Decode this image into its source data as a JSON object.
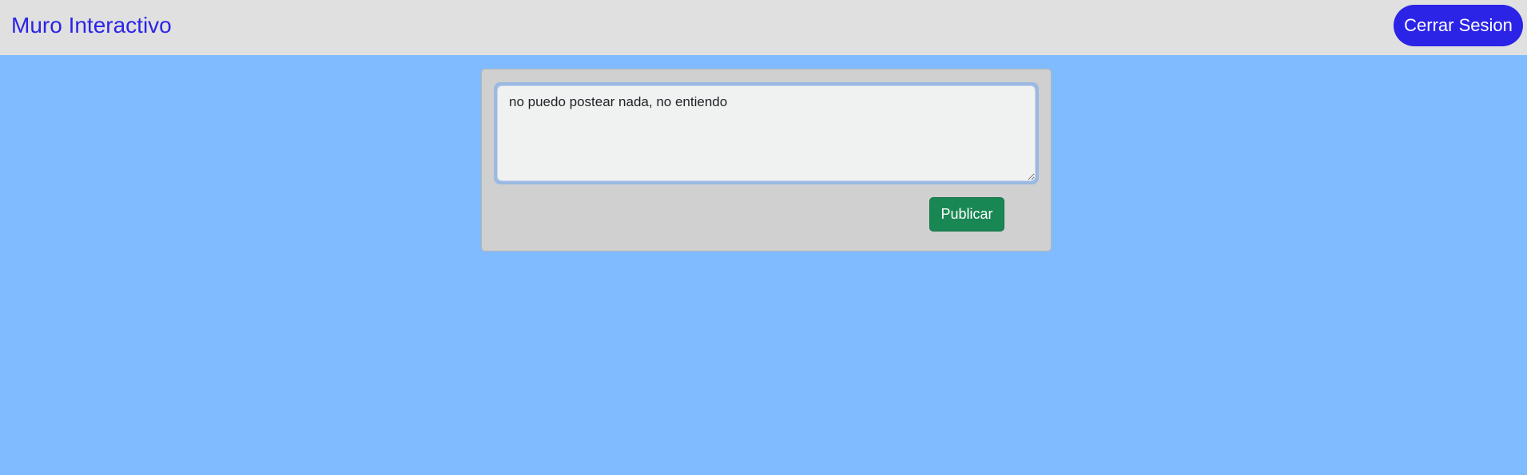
{
  "header": {
    "brand": "Muro Interactivo",
    "logout_label": "Cerrar Sesion"
  },
  "composer": {
    "textarea_value": "no puedo postear nada, no entiendo",
    "publish_label": "Publicar"
  },
  "colors": {
    "page_background": "#80bbff",
    "header_background": "#e0e0e0",
    "brand": "#2b24e6",
    "logout_button": "#2b24e6",
    "card_background": "#d0d0d0",
    "publish_button": "#198754"
  }
}
